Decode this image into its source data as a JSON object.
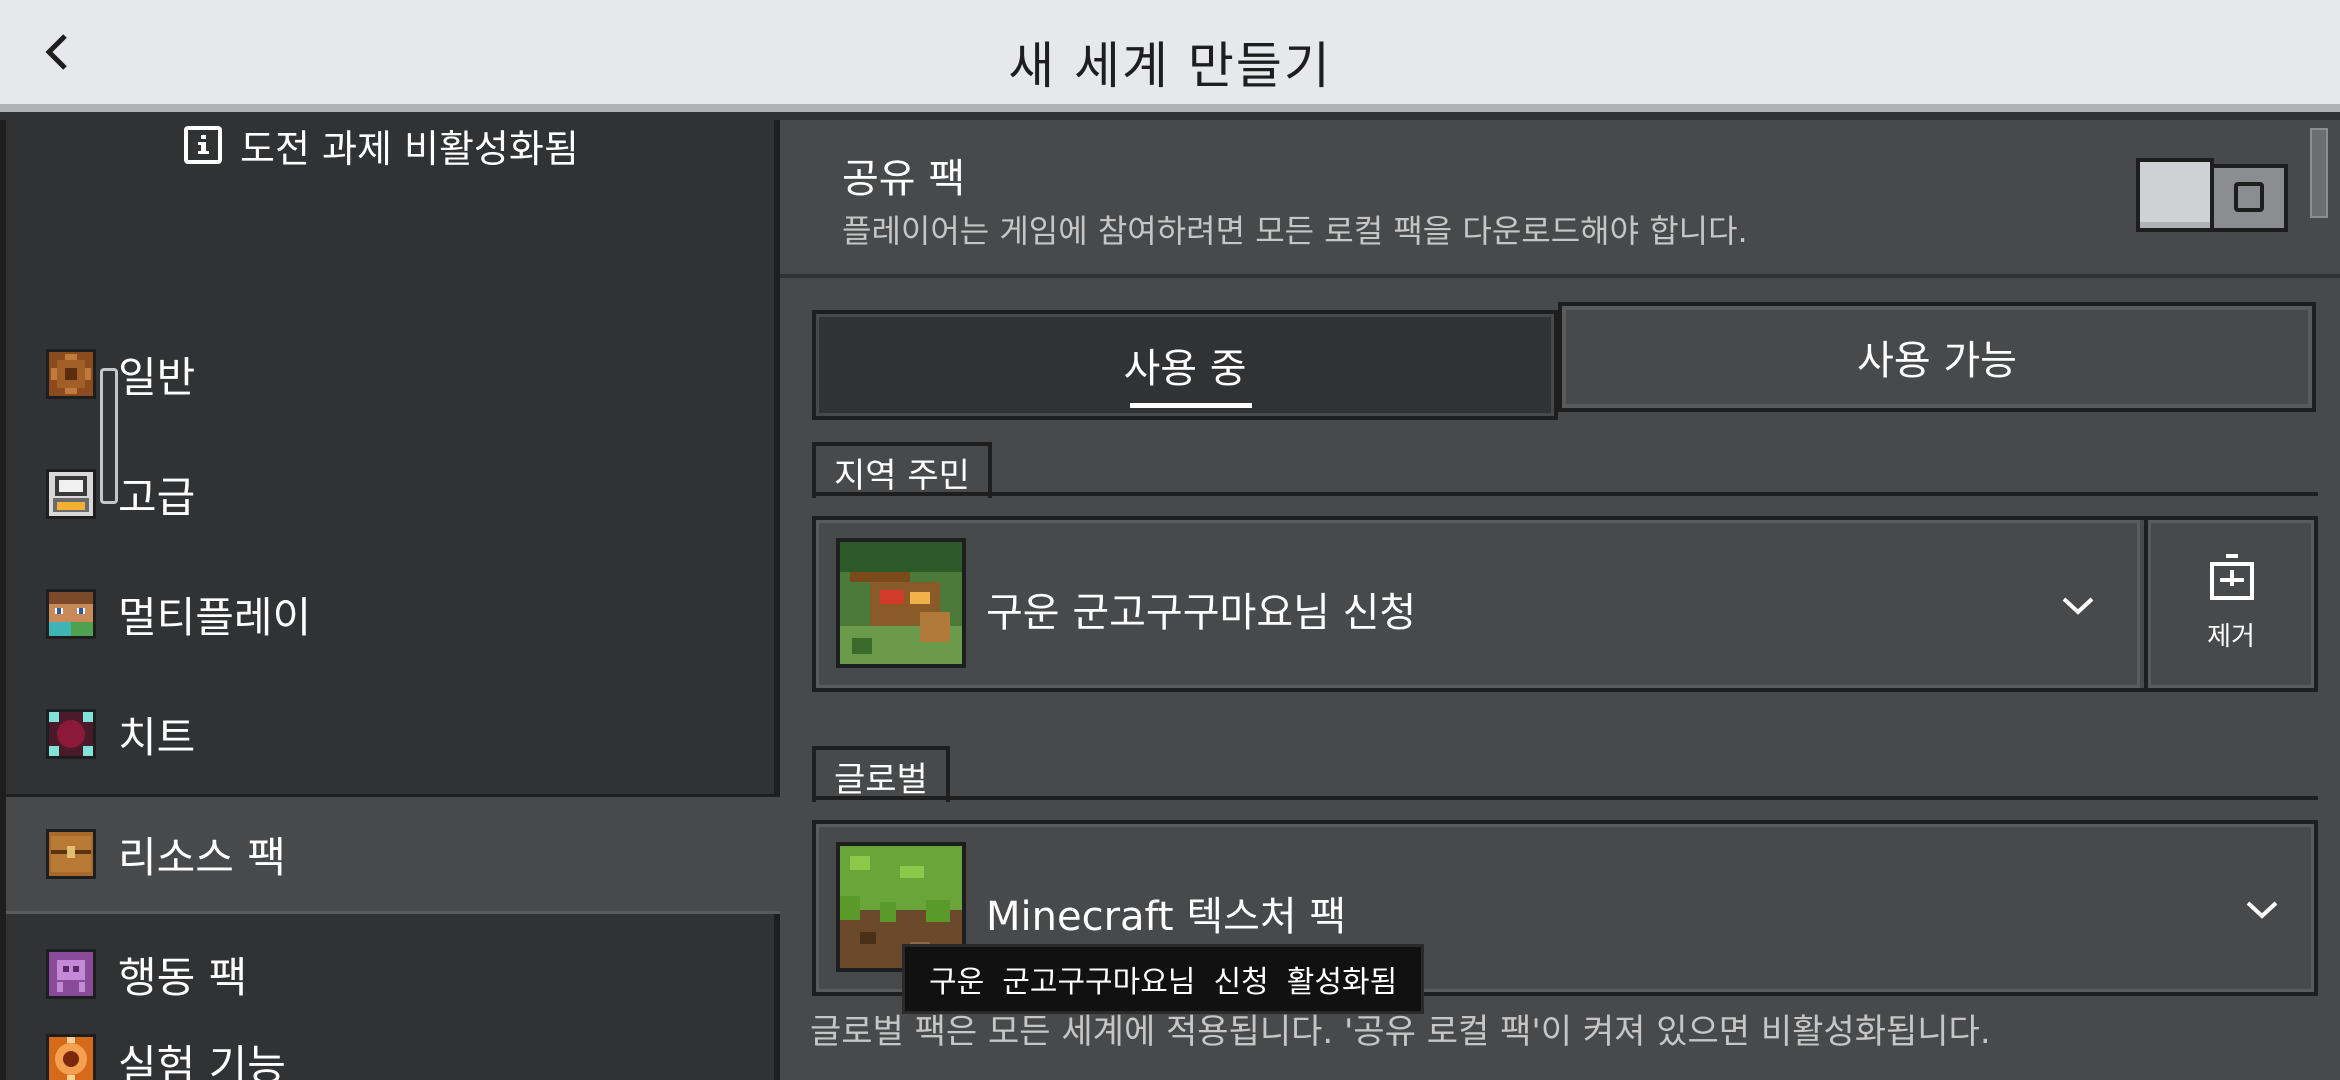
{
  "header": {
    "title": "새 세계 만들기",
    "back_icon": "chevron-left-icon"
  },
  "sidebar": {
    "notice": "도전 과제 비활성화됨",
    "notice_icon": "info-icon",
    "items": [
      {
        "label": "일반",
        "icon": "gear-icon"
      },
      {
        "label": "고급",
        "icon": "advanced-icon"
      },
      {
        "label": "멀티플레이",
        "icon": "players-icon"
      },
      {
        "label": "치트",
        "icon": "cheats-icon"
      },
      {
        "label": "리소스 팩",
        "icon": "chest-icon",
        "active": true
      },
      {
        "label": "행동 팩",
        "icon": "behavior-icon"
      },
      {
        "label": "실험 기능",
        "icon": "experiment-icon"
      }
    ]
  },
  "shared_packs": {
    "title": "공유 팩",
    "description": "플레이어는 게임에 참여하려면 모든 로컬 팩을 다운로드해야 합니다.",
    "toggle_on": false
  },
  "tabs": {
    "active": "사용 중",
    "available": "사용 가능"
  },
  "local_section": {
    "label": "지역 주민",
    "pack_name": "구운 군고구구마요님 신청",
    "remove_label": "제거"
  },
  "global_section": {
    "label": "글로벌",
    "pack_name": "Minecraft 텍스처 팩"
  },
  "tooltip": "구운 군고구구마요님 신청 활성화됨",
  "footnote": "글로벌 팩은 모든 세계에 적용됩니다. '공유 로컬 팩'이 켜져 있으면 비활성화됩니다.",
  "colors": {
    "header_bg": "#e6e8eb",
    "panel_bg": "#48494a",
    "sidebar_bg": "#313233",
    "border": "#1e1e1f"
  }
}
